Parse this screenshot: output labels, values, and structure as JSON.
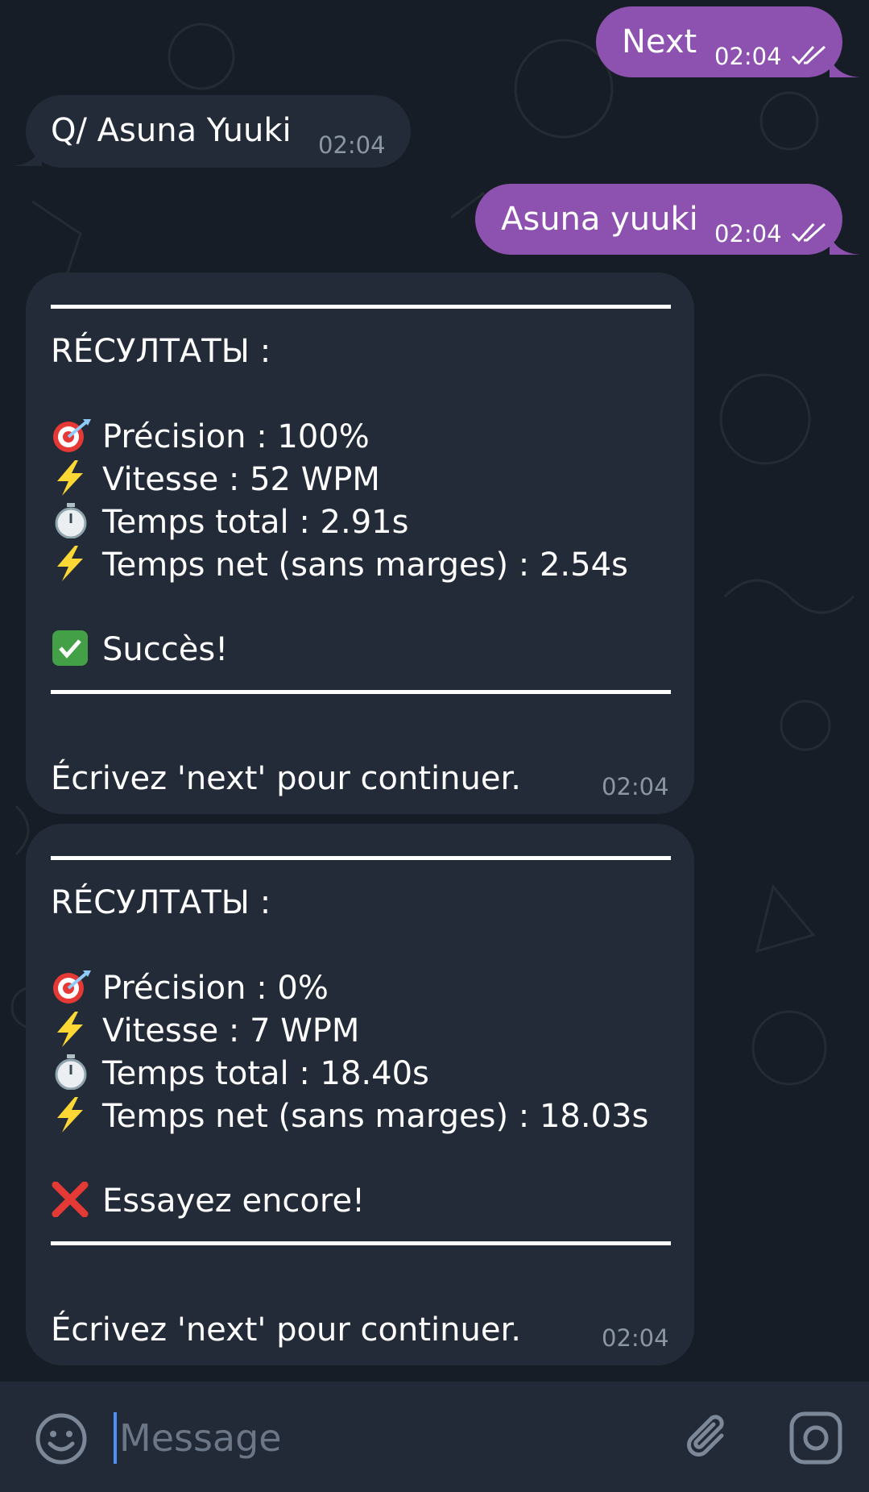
{
  "messages": [
    {
      "text": "Next",
      "time": "02:04",
      "direction": "outgoing",
      "status": "read"
    },
    {
      "text": "Q/ Asuna Yuuki",
      "time": "02:04",
      "direction": "incoming"
    },
    {
      "text": "Asuna yuuki",
      "time": "02:04",
      "direction": "outgoing",
      "status": "read"
    }
  ],
  "results": [
    {
      "heading": "RÉCУЛТАТЫ :",
      "lines": [
        {
          "icon": "target-icon",
          "text": "Précision : 100%"
        },
        {
          "icon": "lightning-icon",
          "text": "Vitesse : 52 WPM"
        },
        {
          "icon": "stopwatch-icon",
          "text": "Temps total : 2.91s"
        },
        {
          "icon": "lightning-icon",
          "text": "Temps net (sans marges) : 2.54s"
        }
      ],
      "verdict_icon": "check-mark-icon",
      "verdict": "Succès!",
      "footer": "Écrivez 'next' pour continuer.",
      "time": "02:04"
    },
    {
      "heading": "RÉCУЛТАТЫ :",
      "lines": [
        {
          "icon": "target-icon",
          "text": "Précision : 0%"
        },
        {
          "icon": "lightning-icon",
          "text": "Vitesse : 7 WPM"
        },
        {
          "icon": "stopwatch-icon",
          "text": "Temps total : 18.40s"
        },
        {
          "icon": "lightning-icon",
          "text": "Temps net (sans marges) : 18.03s"
        }
      ],
      "verdict_icon": "cross-mark-icon",
      "verdict": "Essayez encore!",
      "footer": "Écrivez 'next' pour continuer.",
      "time": "02:04"
    }
  ],
  "composer": {
    "placeholder": "Message",
    "left_icon": "emoji-icon",
    "right_icons": [
      "attach-icon",
      "camera-icon"
    ]
  },
  "colors": {
    "background": "#171d26",
    "outgoing_bubble": "#8d52b0",
    "incoming_bubble": "#242b38",
    "composer_bar": "#222a38",
    "cursor": "#4f8ef7"
  }
}
